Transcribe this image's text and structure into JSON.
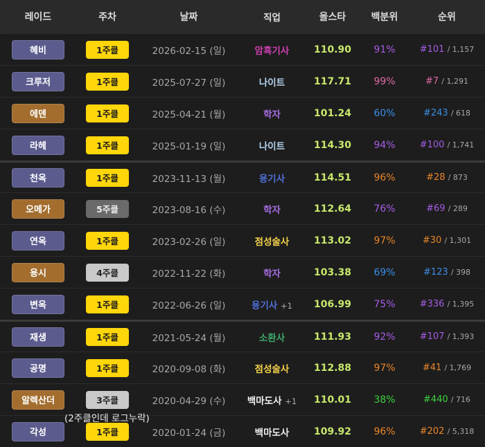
{
  "headers": {
    "raid": "레이드",
    "week": "주차",
    "date": "날짜",
    "job": "직업",
    "allstar": "올스타",
    "percent": "백분위",
    "rank": "순위"
  },
  "rows": [
    {
      "raid": "혜비",
      "raid_color": "#5b5b8e",
      "week": "1주클",
      "week_style": "yellow",
      "date": "2026-02-15 (일)",
      "job": "암흑기사",
      "job_color": "#d03fb2",
      "job_extra": "",
      "score": "110.90",
      "pct": "91%",
      "pct_color": "#a65ce6",
      "rank": "#101",
      "rank_color": "#a65ce6",
      "total": "/ 1,157",
      "sep": false
    },
    {
      "raid": "크루저",
      "raid_color": "#5b5b8e",
      "week": "1주클",
      "week_style": "yellow",
      "date": "2025-07-27 (일)",
      "job": "나이트",
      "job_color": "#b6d3ee",
      "job_extra": "",
      "score": "117.71",
      "pct": "99%",
      "pct_color": "#e06aa6",
      "rank": "#7",
      "rank_color": "#e06aa6",
      "total": "/ 1,291",
      "sep": false
    },
    {
      "raid": "에덴",
      "raid_color": "#a36d2e",
      "week": "1주클",
      "week_style": "yellow",
      "date": "2025-04-21 (월)",
      "job": "학자",
      "job_color": "#a56de0",
      "job_extra": "",
      "score": "101.24",
      "pct": "60%",
      "pct_color": "#3a8fe6",
      "rank": "#243",
      "rank_color": "#3a8fe6",
      "total": "/ 618",
      "sep": false
    },
    {
      "raid": "라헤",
      "raid_color": "#5b5b8e",
      "week": "1주클",
      "week_style": "yellow",
      "date": "2025-01-19 (일)",
      "job": "나이트",
      "job_color": "#b6d3ee",
      "job_extra": "",
      "score": "114.30",
      "pct": "94%",
      "pct_color": "#a65ce6",
      "rank": "#100",
      "rank_color": "#a65ce6",
      "total": "/ 1,741",
      "sep": false
    },
    {
      "raid": "천옥",
      "raid_color": "#5b5b8e",
      "week": "1주클",
      "week_style": "yellow",
      "date": "2023-11-13 (월)",
      "job": "용기사",
      "job_color": "#4f6fd6",
      "job_extra": "",
      "score": "114.51",
      "pct": "96%",
      "pct_color": "#e8862a",
      "rank": "#28",
      "rank_color": "#e8862a",
      "total": "/ 873",
      "sep": true
    },
    {
      "raid": "오메가",
      "raid_color": "#a36d2e",
      "week": "5주클",
      "week_style": "gray",
      "date": "2023-08-16 (수)",
      "job": "학자",
      "job_color": "#a56de0",
      "job_extra": "",
      "score": "112.64",
      "pct": "76%",
      "pct_color": "#a65ce6",
      "rank": "#69",
      "rank_color": "#a65ce6",
      "total": "/ 289",
      "sep": false
    },
    {
      "raid": "연옥",
      "raid_color": "#5b5b8e",
      "week": "1주클",
      "week_style": "yellow",
      "date": "2023-02-26 (일)",
      "job": "점성술사",
      "job_color": "#f2d04a",
      "job_extra": "",
      "score": "113.02",
      "pct": "97%",
      "pct_color": "#e8862a",
      "rank": "#30",
      "rank_color": "#e8862a",
      "total": "/ 1,301",
      "sep": false
    },
    {
      "raid": "용시",
      "raid_color": "#a36d2e",
      "week": "4주클",
      "week_style": "light",
      "date": "2022-11-22 (화)",
      "job": "학자",
      "job_color": "#a56de0",
      "job_extra": "",
      "score": "103.38",
      "pct": "69%",
      "pct_color": "#3a8fe6",
      "rank": "#123",
      "rank_color": "#3a8fe6",
      "total": "/ 398",
      "sep": false
    },
    {
      "raid": "변옥",
      "raid_color": "#5b5b8e",
      "week": "1주클",
      "week_style": "yellow",
      "date": "2022-06-26 (일)",
      "job": "용기사",
      "job_color": "#4f6fd6",
      "job_extra": "+1",
      "score": "106.99",
      "pct": "75%",
      "pct_color": "#a65ce6",
      "rank": "#336",
      "rank_color": "#a65ce6",
      "total": "/ 1,395",
      "sep": false
    },
    {
      "raid": "재생",
      "raid_color": "#5b5b8e",
      "week": "1주클",
      "week_style": "yellow",
      "date": "2021-05-24 (월)",
      "job": "소환사",
      "job_color": "#3fa86a",
      "job_extra": "",
      "score": "111.93",
      "pct": "92%",
      "pct_color": "#a65ce6",
      "rank": "#107",
      "rank_color": "#a65ce6",
      "total": "/ 1,393",
      "sep": true
    },
    {
      "raid": "공명",
      "raid_color": "#5b5b8e",
      "week": "1주클",
      "week_style": "yellow",
      "date": "2020-09-08 (화)",
      "job": "점성술사",
      "job_color": "#f2d04a",
      "job_extra": "",
      "score": "112.88",
      "pct": "97%",
      "pct_color": "#e8862a",
      "rank": "#41",
      "rank_color": "#e8862a",
      "total": "/ 1,769",
      "sep": false
    },
    {
      "raid": "알렉산더",
      "raid_color": "#a36d2e",
      "week": "3주클",
      "week_style": "light",
      "date": "2020-04-29 (수)",
      "job": "백마도사",
      "job_color": "#f0f0f0",
      "job_extra": "+1",
      "score": "110.01",
      "pct": "38%",
      "pct_color": "#3ed13e",
      "rank": "#440",
      "rank_color": "#3ed13e",
      "total": "/ 716",
      "sep": false,
      "note": "(2주클인데 로그누락)"
    },
    {
      "raid": "각성",
      "raid_color": "#5b5b8e",
      "week": "1주클",
      "week_style": "yellow",
      "date": "2020-01-24 (금)",
      "job": "백마도사",
      "job_color": "#f0f0f0",
      "job_extra": "",
      "score": "109.92",
      "pct": "96%",
      "pct_color": "#e8862a",
      "rank": "#202",
      "rank_color": "#e8862a",
      "total": "/ 5,318",
      "sep": false
    }
  ]
}
